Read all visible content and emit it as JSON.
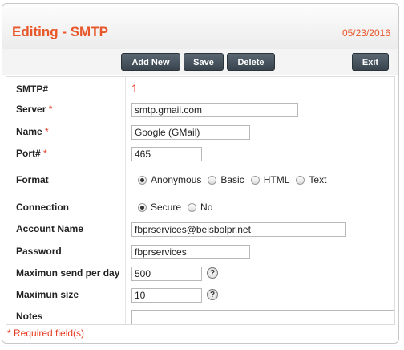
{
  "header": {
    "title": "Editing - SMTP",
    "date": "05/23/2016"
  },
  "toolbar": {
    "add_new": "Add New",
    "save": "Save",
    "delete": "Delete",
    "exit": "Exit"
  },
  "form": {
    "smtp_num": {
      "label": "SMTP#",
      "value": "1"
    },
    "server": {
      "label": "Server",
      "required": "*",
      "value": "smtp.gmail.com"
    },
    "name": {
      "label": "Name",
      "required": "*",
      "value": "Google (GMail)"
    },
    "port": {
      "label": "Port#",
      "required": "*",
      "value": "465"
    },
    "format": {
      "label": "Format",
      "options": [
        "Anonymous",
        "Basic",
        "HTML",
        "Text"
      ],
      "selected": "Anonymous"
    },
    "connection": {
      "label": "Connection",
      "options": [
        "Secure",
        "No"
      ],
      "selected": "Secure"
    },
    "account_name": {
      "label": "Account Name",
      "value": "fbprservices@beisbolpr.net"
    },
    "password": {
      "label": "Password",
      "value": "fbprservices"
    },
    "max_send": {
      "label": "Maximun send per day",
      "value": "500"
    },
    "max_size": {
      "label": "Maximun size",
      "value": "10"
    },
    "notes": {
      "label": "Notes",
      "value": ""
    },
    "help_glyph": "?"
  },
  "footer": {
    "required_note": "* Required field(s)"
  },
  "colors": {
    "accent": "#e8572a",
    "required": "#e63a1f",
    "button": "#3f4a54"
  }
}
